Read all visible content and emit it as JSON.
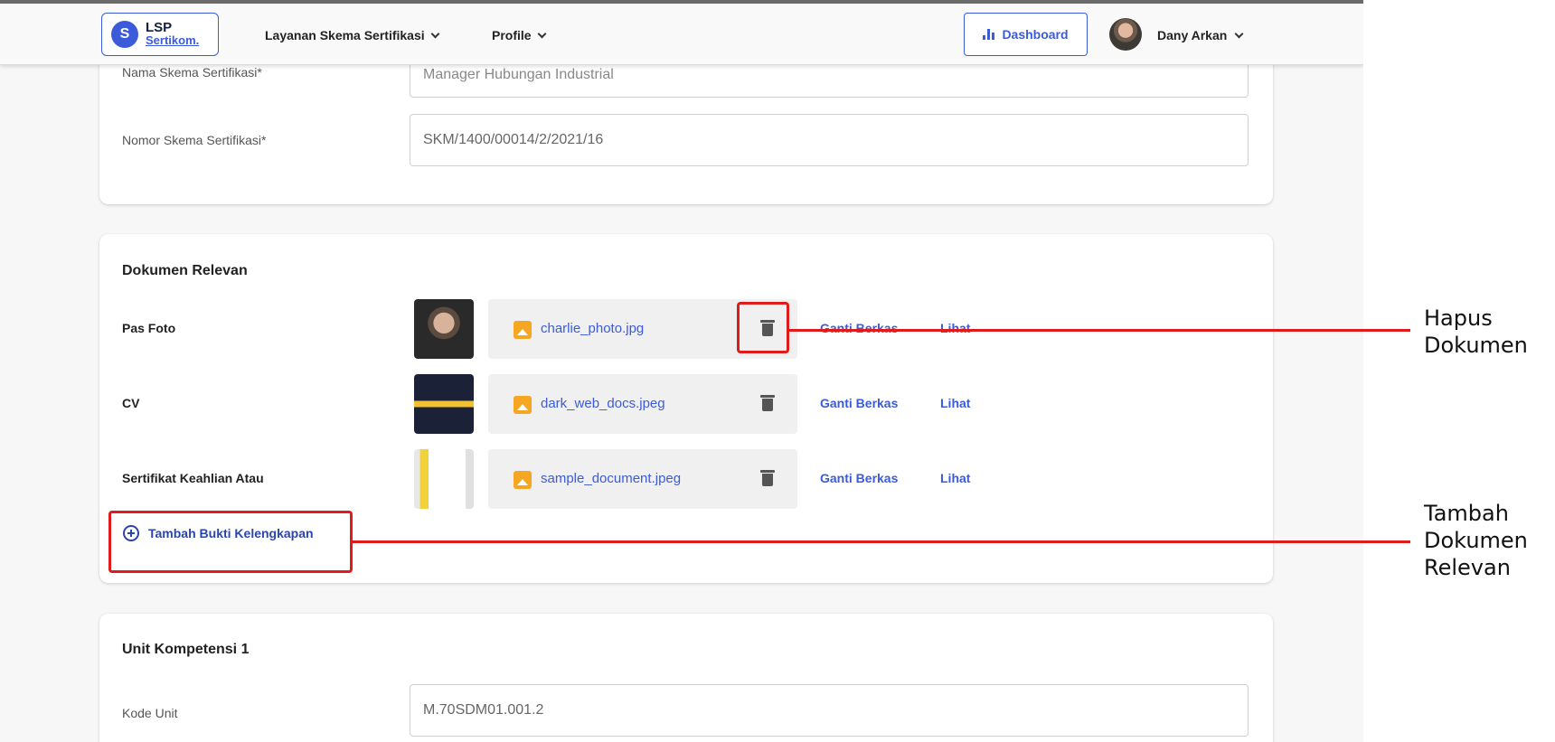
{
  "header": {
    "logo": {
      "line1": "LSP",
      "line2": "Sertikom."
    },
    "nav": [
      {
        "label": "Layanan Skema Sertifikasi"
      },
      {
        "label": "Profile"
      }
    ],
    "dashboard_label": "Dashboard",
    "user_name": "Dany Arkan"
  },
  "scheme_card": {
    "name_label": "Nama Skema Sertifikasi*",
    "name_value": "Manager Hubungan Industrial",
    "number_label": "Nomor Skema Sertifikasi*",
    "number_value": "SKM/1400/00014/2/2021/16"
  },
  "documents": {
    "title": "Dokumen Relevan",
    "rows": [
      {
        "label": "Pas Foto",
        "file": "charlie_photo.jpg",
        "replace": "Ganti Berkas",
        "view": "Lihat"
      },
      {
        "label": "CV",
        "file": "dark_web_docs.jpeg",
        "replace": "Ganti Berkas",
        "view": "Lihat"
      },
      {
        "label": "Sertifikat Keahlian Atau",
        "file": "sample_document.jpeg",
        "replace": "Ganti Berkas",
        "view": "Lihat"
      }
    ],
    "add_label": "Tambah Bukti Kelengkapan"
  },
  "unit_card": {
    "title": "Unit Kompetensi 1",
    "code_label": "Kode Unit",
    "code_value": "M.70SDM01.001.2"
  },
  "annotations": {
    "delete": {
      "line1": "Hapus",
      "line2": "Dokumen"
    },
    "add": {
      "line1": "Tambah",
      "line2": "Dokumen",
      "line3": "Relevan"
    },
    "color": "#e01b1b"
  },
  "colors": {
    "accent": "#3b5bdb",
    "file_icon": "#f5a623"
  }
}
